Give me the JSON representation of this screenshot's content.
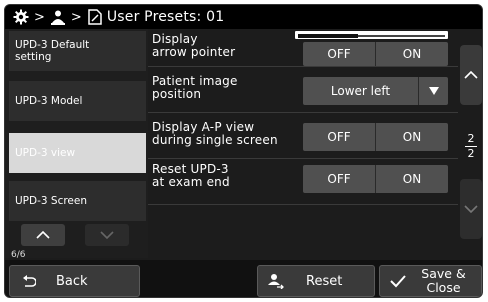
{
  "title_bar": {
    "separator": ">",
    "title": "User Presets: 01"
  },
  "sidebar": {
    "items": [
      {
        "label": "UPD-3 Default setting",
        "active": false
      },
      {
        "label": "UPD-3 Model",
        "active": false
      },
      {
        "label": "UPD-3 view",
        "active": true
      },
      {
        "label": "UPD-3 Screen",
        "active": false
      }
    ],
    "page": "6/6"
  },
  "settings": {
    "display_arrow_pointer": {
      "label_line1": "Display",
      "label_line2": "arrow pointer",
      "off": "OFF",
      "on": "ON"
    },
    "patient_image_position": {
      "label_line1": "Patient image",
      "label_line2": "position",
      "value": "Lower left"
    },
    "display_ap_view": {
      "label_line1": "Display A-P view",
      "label_line2": "during single screen",
      "off": "OFF",
      "on": "ON"
    },
    "reset_upd3": {
      "label_line1": "Reset UPD-3",
      "label_line2": "at exam end",
      "off": "OFF",
      "on": "ON"
    }
  },
  "pager": {
    "current": "2",
    "total": "2"
  },
  "bottom_bar": {
    "back_label": "Back",
    "reset_label": "Reset",
    "save_label": "Save &\nClose"
  },
  "colors": {
    "panel_bg": "#1c1c1c",
    "button_bg": "#505050",
    "active_item_bg": "#d9d9d9"
  },
  "icons": [
    "gear-icon",
    "user-icon",
    "document-icon",
    "chevron-up-icon",
    "chevron-down-icon",
    "back-arrow-icon",
    "reset-user-icon",
    "checkmark-icon",
    "dropdown-triangle-icon"
  ]
}
